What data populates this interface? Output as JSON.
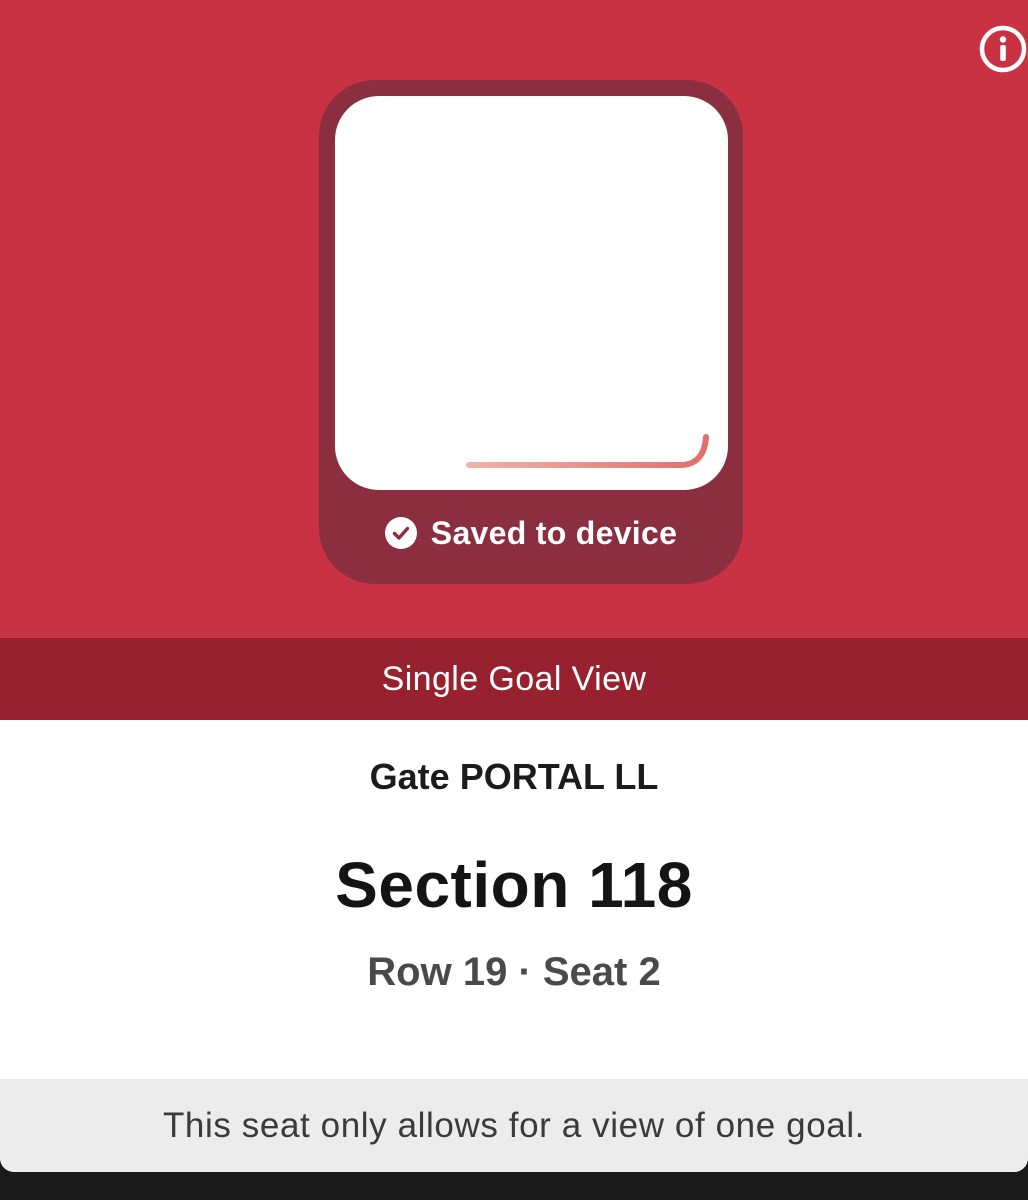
{
  "ticket": {
    "icons": {
      "info": "info-circle-icon",
      "saved": "check-circle-icon"
    },
    "saved_label": "Saved to device",
    "view_label": "Single Goal View",
    "gate": "Gate PORTAL LL",
    "section": "Section 118",
    "row_seat": "Row 19 · Seat 2",
    "note": "This seat only allows for a view of one goal."
  },
  "colors": {
    "hero_background": "#c93243",
    "barcode_card": "#8b2e3f",
    "view_bar": "#98212f",
    "timer_line": "#e06f6b",
    "note_background": "#ececec"
  }
}
